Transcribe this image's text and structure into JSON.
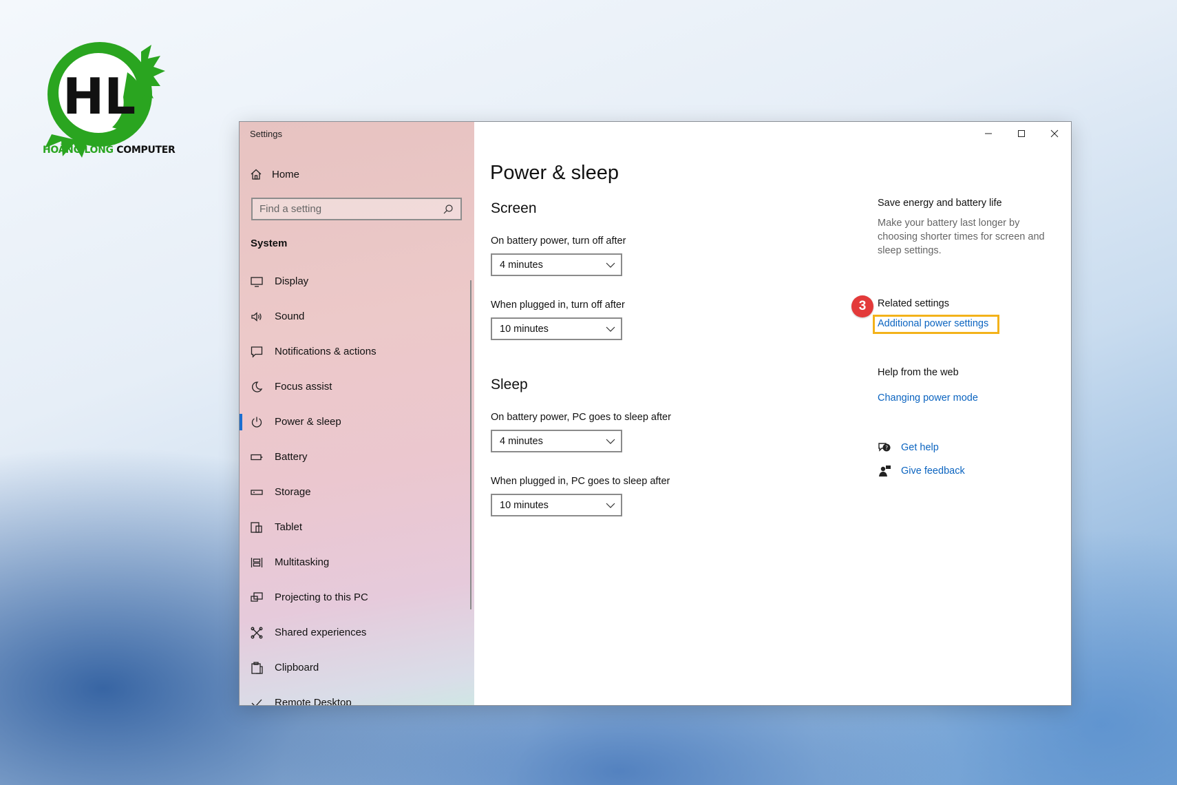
{
  "brand": {
    "logo_part1": "HOÀNG LONG",
    "logo_part2": "COMPUTER",
    "logo_mark": "HL"
  },
  "window": {
    "title": "Settings",
    "controls": {
      "minimize": "minimize-icon",
      "maximize": "maximize-icon",
      "close": "close-icon"
    }
  },
  "sidebar": {
    "home_label": "Home",
    "search_placeholder": "Find a setting",
    "section_label": "System",
    "items": [
      {
        "label": "Display",
        "icon": "display-icon"
      },
      {
        "label": "Sound",
        "icon": "speaker-icon"
      },
      {
        "label": "Notifications & actions",
        "icon": "notification-icon"
      },
      {
        "label": "Focus assist",
        "icon": "moon-icon"
      },
      {
        "label": "Power & sleep",
        "icon": "power-icon",
        "active": true
      },
      {
        "label": "Battery",
        "icon": "battery-icon"
      },
      {
        "label": "Storage",
        "icon": "storage-icon"
      },
      {
        "label": "Tablet",
        "icon": "tablet-icon"
      },
      {
        "label": "Multitasking",
        "icon": "multitasking-icon"
      },
      {
        "label": "Projecting to this PC",
        "icon": "projecting-icon"
      },
      {
        "label": "Shared experiences",
        "icon": "shared-icon"
      },
      {
        "label": "Clipboard",
        "icon": "clipboard-icon"
      },
      {
        "label": "Remote Desktop",
        "icon": "remote-icon"
      }
    ]
  },
  "main": {
    "title": "Power & sleep",
    "screen": {
      "heading": "Screen",
      "battery_label": "On battery power, turn off after",
      "battery_value": "4 minutes",
      "plugged_label": "When plugged in, turn off after",
      "plugged_value": "10 minutes"
    },
    "sleep": {
      "heading": "Sleep",
      "battery_label": "On battery power, PC goes to sleep after",
      "battery_value": "4 minutes",
      "plugged_label": "When plugged in, PC goes to sleep after",
      "plugged_value": "10 minutes"
    }
  },
  "right_panel": {
    "save_heading": "Save energy and battery life",
    "save_desc": "Make your battery last longer by choosing shorter times for screen and sleep settings.",
    "related_heading": "Related settings",
    "related_link": "Additional power settings",
    "step_badge": "3",
    "help_heading": "Help from the web",
    "help_link": "Changing power mode",
    "get_help": "Get help",
    "give_feedback": "Give feedback"
  },
  "colors": {
    "accent": "#1a6fd1",
    "link": "#0b64c0",
    "highlight": "#f3b21a",
    "badge": "#e33a3a",
    "logo_green": "#2aa520"
  }
}
